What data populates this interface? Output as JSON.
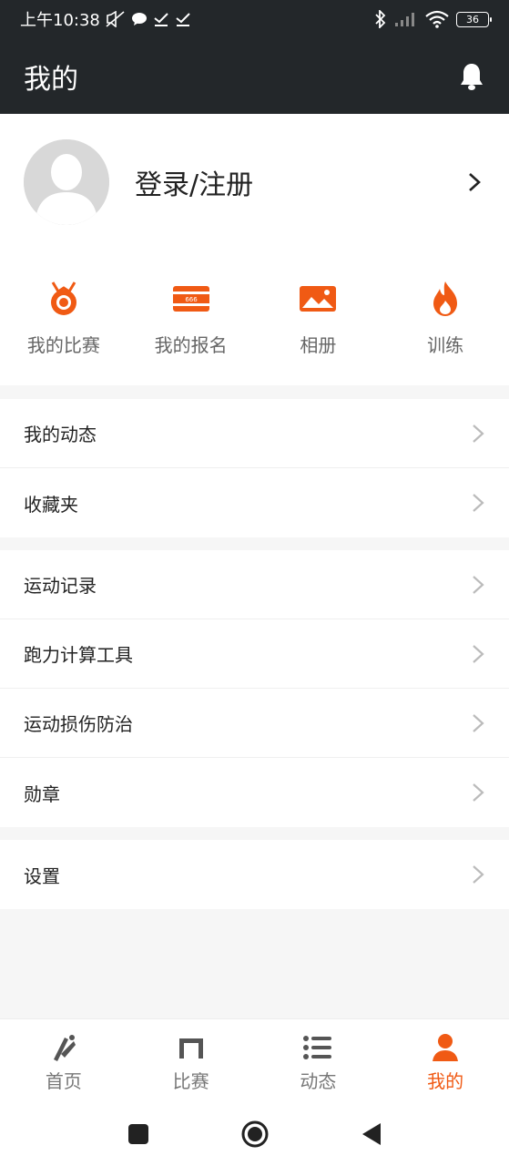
{
  "status": {
    "time": "上午10:38",
    "battery": "36"
  },
  "header": {
    "title": "我的"
  },
  "profile": {
    "login_label": "登录/注册"
  },
  "quick_actions": [
    {
      "label": "我的比赛",
      "icon": "medal-icon"
    },
    {
      "label": "我的报名",
      "icon": "ticket-icon"
    },
    {
      "label": "相册",
      "icon": "photo-icon"
    },
    {
      "label": "训练",
      "icon": "flame-icon"
    }
  ],
  "menu_groups": [
    [
      "我的动态",
      "收藏夹"
    ],
    [
      "运动记录",
      "跑力计算工具",
      "运动损伤防治",
      "勋章"
    ],
    [
      "设置"
    ]
  ],
  "tabs": [
    {
      "label": "首页",
      "icon": "home-icon",
      "active": false
    },
    {
      "label": "比赛",
      "icon": "match-icon",
      "active": false
    },
    {
      "label": "动态",
      "icon": "list-icon",
      "active": false
    },
    {
      "label": "我的",
      "icon": "person-icon",
      "active": true
    }
  ],
  "ticket_text": "666",
  "colors": {
    "accent": "#f05a14",
    "header_bg": "#23272a"
  }
}
